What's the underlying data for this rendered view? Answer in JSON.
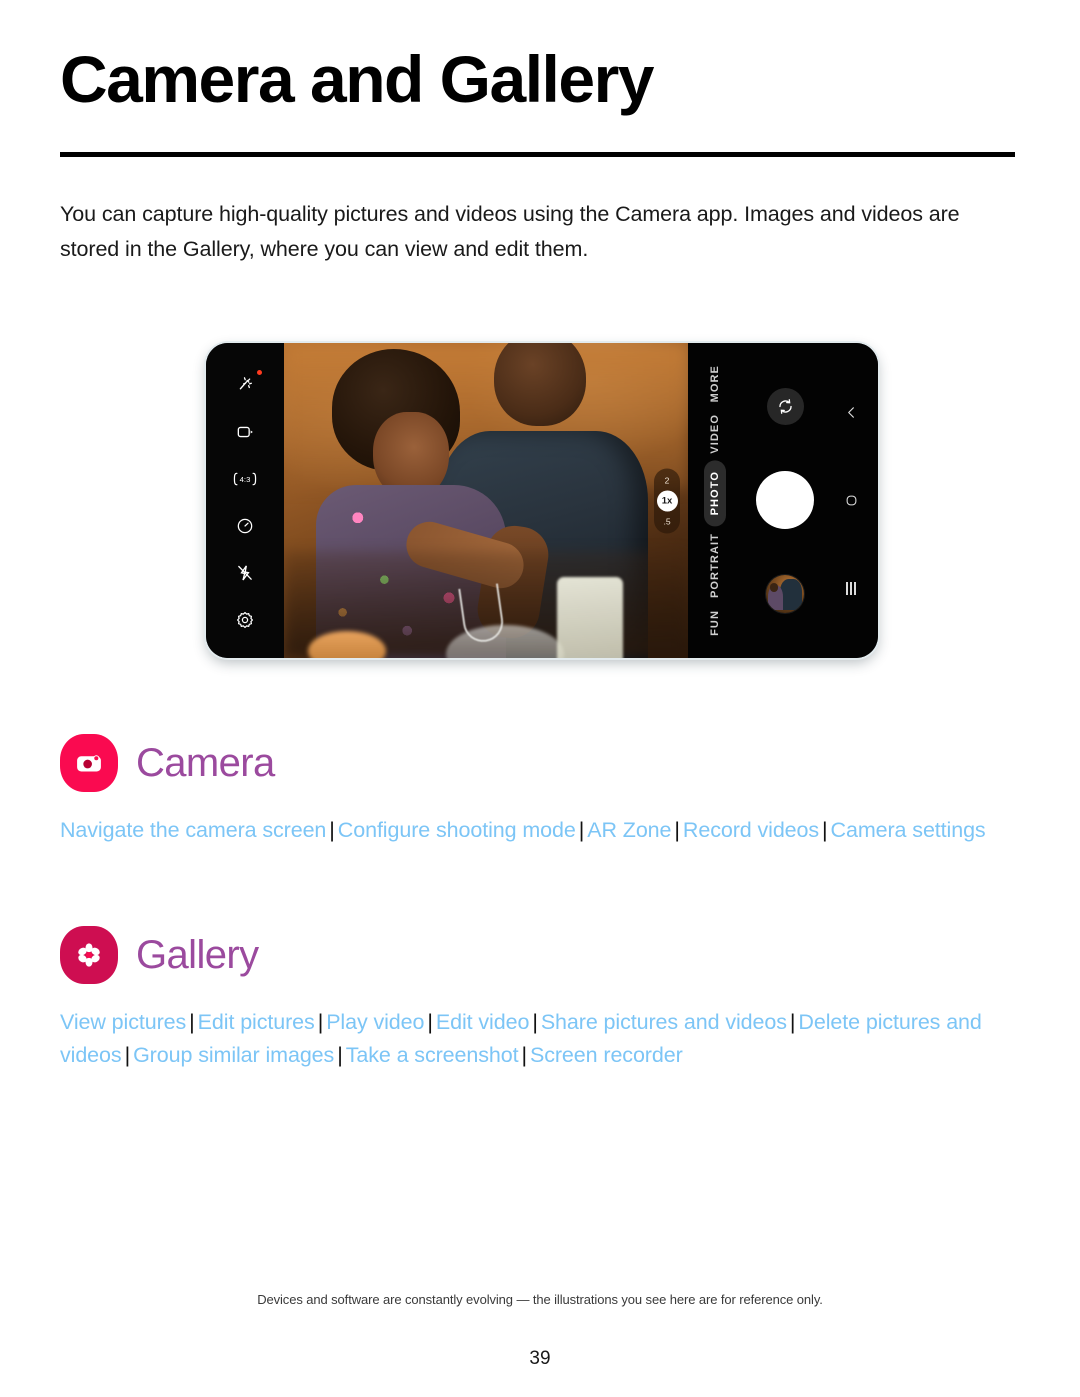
{
  "title": "Camera and Gallery",
  "intro": "You can capture high-quality pictures and videos using the Camera app. Images and videos are stored in the Gallery, where you can view and edit them.",
  "phone_illustration": {
    "left_rail": [
      {
        "icon": "magic-wand-icon",
        "label": "Scene optimizer",
        "badge": true
      },
      {
        "icon": "motion-photo-icon",
        "label": "Motion photo"
      },
      {
        "icon": "aspect-ratio-icon",
        "label": "4:3"
      },
      {
        "icon": "timer-icon",
        "label": "Timer"
      },
      {
        "icon": "flash-off-icon",
        "label": "Flash off"
      },
      {
        "icon": "settings-gear-icon",
        "label": "Settings"
      }
    ],
    "zoom": {
      "steps": [
        "2",
        "1x",
        ".5"
      ],
      "selected": "1x"
    },
    "modes": [
      {
        "label": "MORE",
        "active": false
      },
      {
        "label": "VIDEO",
        "active": false
      },
      {
        "label": "PHOTO",
        "active": true
      },
      {
        "label": "PORTRAIT",
        "active": false
      },
      {
        "label": "FUN",
        "active": false
      }
    ],
    "actions": [
      {
        "name": "switch-camera-button",
        "icon": "camera-flip-icon"
      },
      {
        "name": "shutter-button",
        "icon": "shutter-icon"
      },
      {
        "name": "gallery-thumbnail-button",
        "icon": "photo-thumbnail"
      }
    ],
    "navigation_bar": [
      {
        "name": "back-button",
        "icon": "chevron-left-icon"
      },
      {
        "name": "home-button",
        "icon": "home-squircle-icon"
      },
      {
        "name": "recents-button",
        "icon": "recents-bars-icon"
      }
    ]
  },
  "sections": [
    {
      "id": "camera",
      "name": "Camera",
      "icon": "camera-app-icon",
      "icon_color": "#fa0a50",
      "links": [
        "Navigate the camera screen",
        "Configure shooting mode",
        "AR Zone",
        "Record videos",
        "Camera settings"
      ]
    },
    {
      "id": "gallery",
      "name": "Gallery",
      "icon": "gallery-app-icon",
      "icon_color": "#ce0e51",
      "links": [
        "View pictures",
        "Edit pictures",
        "Play video",
        "Edit video",
        "Share pictures and videos",
        "Delete pictures and videos",
        "Group similar images",
        "Take a screenshot",
        "Screen recorder"
      ]
    }
  ],
  "separator": "|",
  "footer": {
    "note": "Devices and software are constantly evolving — the illustrations you see here are for reference only.",
    "page_number": "39"
  },
  "colors": {
    "link": "#7cc5f6",
    "heading_purple": "#9b4a9e",
    "camera_icon": "#fa0a50",
    "gallery_icon": "#ce0e51",
    "rule": "#000000"
  }
}
